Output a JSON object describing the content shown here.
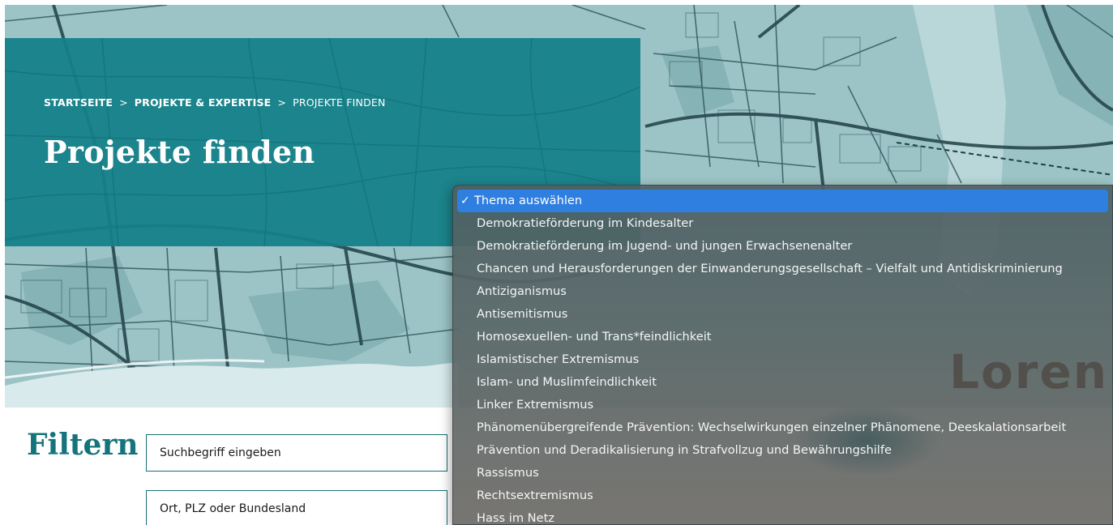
{
  "breadcrumb": {
    "home": "STARTSEITE",
    "section": "PROJEKTE & EXPERTISE",
    "current": "PROJEKTE FINDEN",
    "separator": ">"
  },
  "page_title": "Projekte finden",
  "filter": {
    "heading": "Filtern",
    "search_placeholder": "Suchbegriff eingeben",
    "location_placeholder": "Ort, PLZ oder Bundesland"
  },
  "dropdown": {
    "check_mark": "✓",
    "selected_index": 0,
    "options": [
      "Thema auswählen",
      "Demokratieförderung im Kindesalter",
      "Demokratieförderung im Jugend- und jungen Erwachsenenalter",
      "Chancen und Herausforderungen der Einwanderungsgesellschaft – Vielfalt und Antidiskriminierung",
      "Antiziganismus",
      "Antisemitismus",
      "Homosexuellen- und Trans*feindlichkeit",
      "Islamistischer Extremismus",
      "Islam- und Muslimfeindlichkeit",
      "Linker Extremismus",
      "Phänomenübergreifende Prävention: Wechselwirkungen einzelner Phänomene, Deeskalationsarbeit",
      "Prävention und Deradikalisierung in Strafvollzug und Bewährungshilfe",
      "Rassismus",
      "Rechtsextremismus",
      "Hass im Netz"
    ],
    "background_text": "Loren"
  },
  "colors": {
    "teal_panel": "#148088",
    "map_base": "#9cc4c6",
    "heading_teal": "#15747b",
    "selection_blue": "#2f7fe0"
  }
}
